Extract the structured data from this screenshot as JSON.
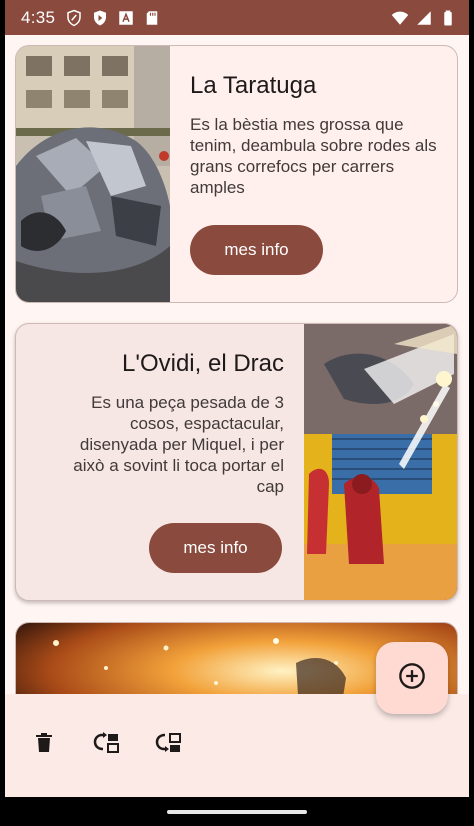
{
  "status_bar": {
    "time": "4:35",
    "left_icons": [
      "shield-outline-icon",
      "play-protect-icon",
      "a-box-icon",
      "sd-card-icon"
    ],
    "right_icons": [
      "wifi-icon",
      "cell-signal-icon",
      "battery-icon"
    ],
    "color": "#8b4a3e"
  },
  "cards": [
    {
      "title": "La Taratuga",
      "description": "Es la bèstia mes grossa que tenim, deambula sobre rodes als grans correfocs per carrers amples",
      "button_label": "mes info",
      "image": "turtle-beast-photo"
    },
    {
      "title": "L'Ovidi, el Drac",
      "description": "Es una peça pesada de 3 cosos, espactacular, disenyada per Miquel, i per això a sovint li toca portar el cap",
      "button_label": "mes info",
      "image": "dragon-correfoc-photo"
    },
    {
      "image": "fireworks-photo"
    }
  ],
  "fab": {
    "icon": "add-circle-icon"
  },
  "bottom_bar": {
    "actions": [
      {
        "icon": "delete-icon"
      },
      {
        "icon": "reorder-forward-icon"
      },
      {
        "icon": "reorder-back-icon"
      }
    ]
  },
  "colors": {
    "primary": "#8b4a3e",
    "surface": "#fff5f3",
    "fab": "#ffdad3"
  }
}
